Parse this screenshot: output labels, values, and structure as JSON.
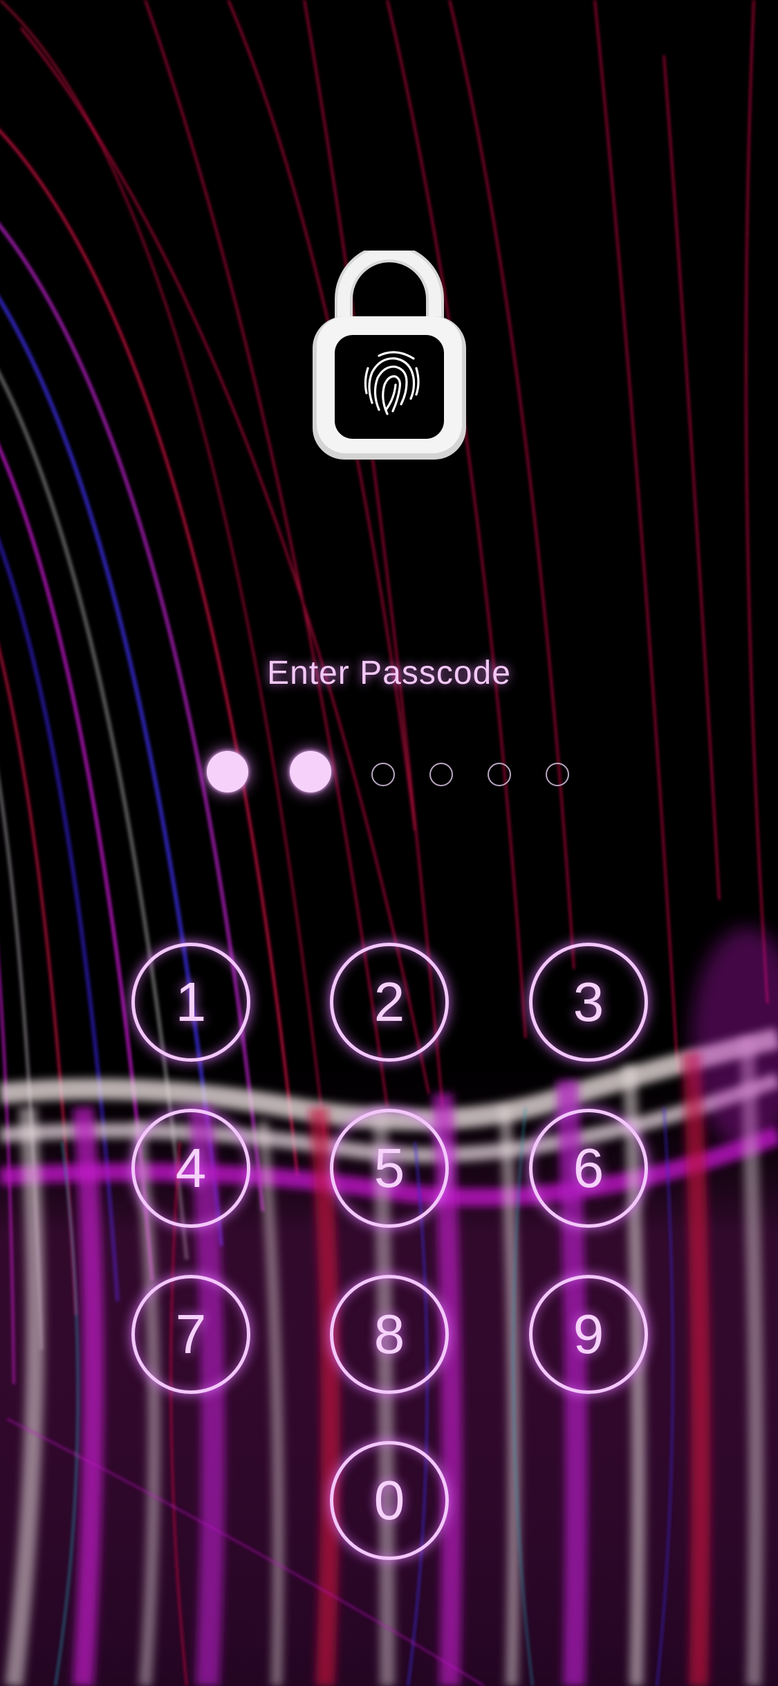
{
  "lock_screen": {
    "prompt": "Enter Passcode",
    "passcode": {
      "length": 6,
      "entered": 2
    },
    "keypad": {
      "keys": [
        "1",
        "2",
        "3",
        "4",
        "5",
        "6",
        "7",
        "8",
        "9",
        "0"
      ]
    },
    "icons": {
      "header": "unlocked-padlock-fingerprint-icon"
    },
    "colors": {
      "background": "#000000",
      "accent_glow": "#e278ff",
      "key_text": "#f6d2fb",
      "light_trail_red": "#c4103f",
      "light_trail_magenta": "#c018c8",
      "light_trail_blue": "#3a2ad8",
      "light_trail_white": "#e8dcdc"
    }
  }
}
